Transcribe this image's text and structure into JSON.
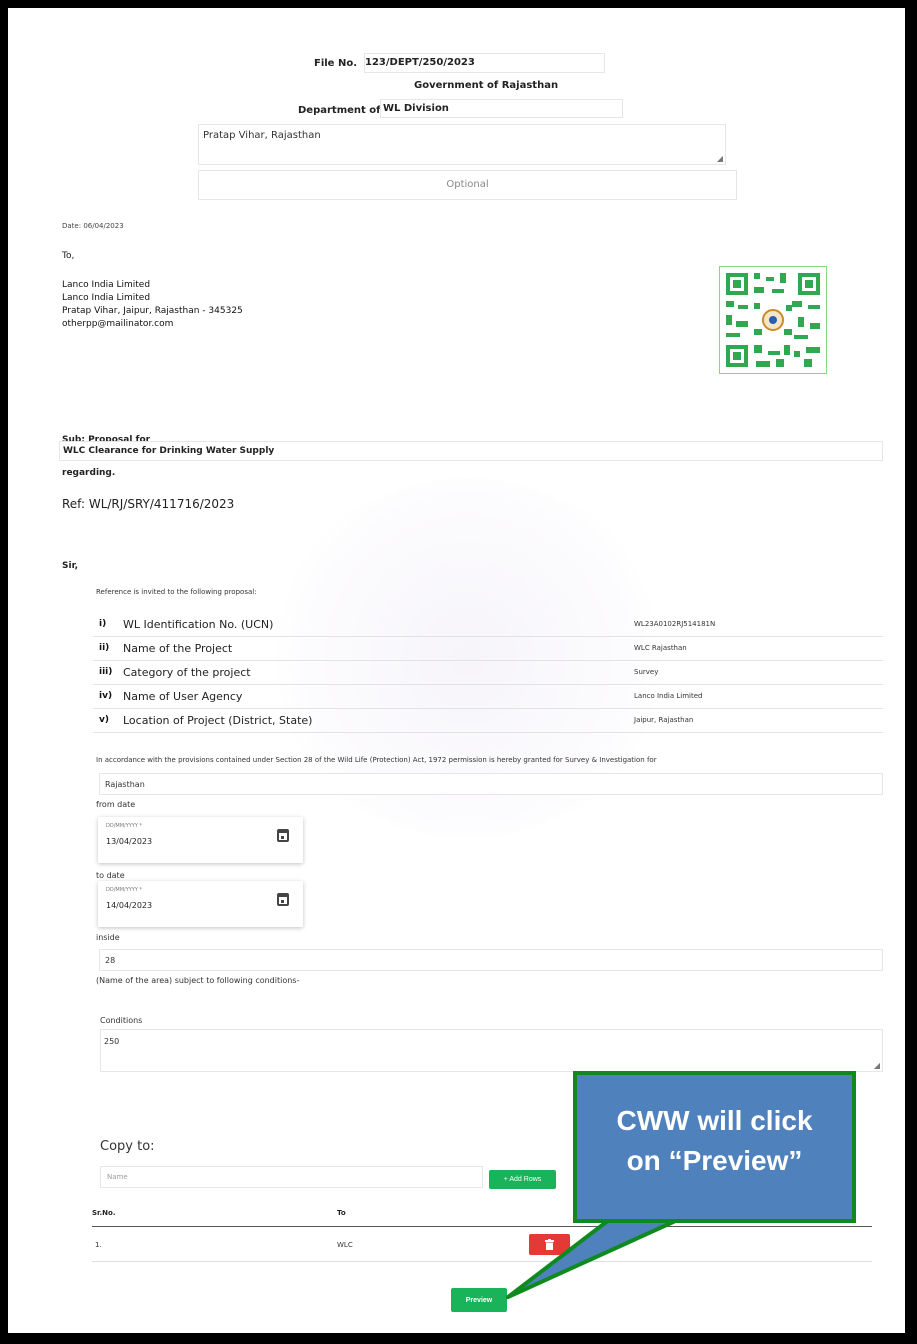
{
  "header": {
    "file_no_label": "File No.",
    "file_no_value": "123/DEPT/250/2023",
    "government": "Government of Rajasthan",
    "department_label": "Department of",
    "department_value": "WL Division",
    "address_value": "Pratap Vihar, Rajasthan",
    "optional_placeholder": "Optional"
  },
  "letter": {
    "date": "Date: 06/04/2023",
    "to_label": "To,",
    "recipient_lines": [
      "Lanco India Limited",
      "Lanco India Limited",
      "Pratap Vihar, Jaipur, Rajasthan - 345325",
      "otherpp@mailinator.com"
    ],
    "sub_label": "Sub:   Proposal for",
    "subject_value": "WLC Clearance for Drinking Water Supply",
    "regarding": "regarding.",
    "ref": "Ref: WL/RJ/SRY/411716/2023",
    "salutation": "Sir,",
    "intro": "Reference is invited to the following proposal:"
  },
  "proposal_rows": [
    {
      "num": "i)",
      "key": "WL Identification No. (UCN)",
      "value": "WL23A0102RJ514181N"
    },
    {
      "num": "ii)",
      "key": "Name of the Project",
      "value": "WLC Rajasthan"
    },
    {
      "num": "iii)",
      "key": "Category of the project",
      "value": "Survey"
    },
    {
      "num": "iv)",
      "key": "Name of User Agency",
      "value": "Lanco India Limited"
    },
    {
      "num": "v)",
      "key": "Location of Project (District, State)",
      "value": "Jaipur, Rajasthan"
    }
  ],
  "grant": {
    "provision_text": "In accordance with the provisions contained under Section 28 of the Wild Life (Protection) Act, 1972 permission is hereby granted for Survey & Investigation for",
    "purpose_value": "Rajasthan",
    "from_label": "from date",
    "from_hint": "DD/MM/YYYY *",
    "from_value": "13/04/2023",
    "to_label": "to date",
    "to_hint": "DD/MM/YYYY *",
    "to_value": "14/04/2023",
    "inside_label": "inside",
    "inside_value": "28",
    "area_note": "(Name of the area) subject to following conditions-",
    "conditions_label": "Conditions",
    "conditions_value": "250"
  },
  "copy_to": {
    "title": "Copy to:",
    "name_placeholder": "Name",
    "add_rows_label": "+ Add Rows",
    "col_srno": "Sr.No.",
    "col_to": "To",
    "rows": [
      {
        "sr": "1.",
        "to": "WLC"
      }
    ]
  },
  "preview_label": "Preview",
  "callout_lines": [
    "CWW will click",
    "on “Preview”"
  ],
  "colors": {
    "accent_green": "#19b35a",
    "delete_red": "#e53935",
    "callout_blue": "#4f81bd",
    "callout_border": "#0e8a1f"
  }
}
